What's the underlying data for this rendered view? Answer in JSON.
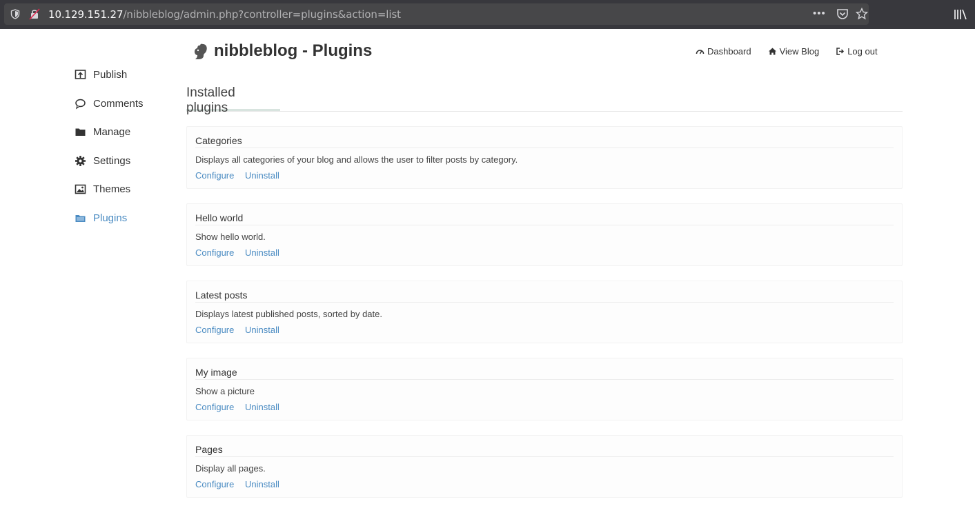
{
  "browser": {
    "url_host": "10.129.151.27",
    "url_path": "/nibbleblog/admin.php?controller=plugins&action=list",
    "more_label": "•••"
  },
  "sidebar": {
    "items": [
      {
        "label": "Publish",
        "icon": "publish-icon"
      },
      {
        "label": "Comments",
        "icon": "comment-icon"
      },
      {
        "label": "Manage",
        "icon": "folder-icon"
      },
      {
        "label": "Settings",
        "icon": "gear-icon"
      },
      {
        "label": "Themes",
        "icon": "image-icon"
      },
      {
        "label": "Plugins",
        "icon": "plugins-icon",
        "active": true
      }
    ]
  },
  "header": {
    "title": "nibbleblog - Plugins",
    "nav": [
      {
        "label": "Dashboard",
        "icon": "dashboard-icon"
      },
      {
        "label": "View Blog",
        "icon": "home-icon"
      },
      {
        "label": "Log out",
        "icon": "logout-icon"
      }
    ]
  },
  "tabs": {
    "active": "Installed plugins"
  },
  "plugins": [
    {
      "name": "Categories",
      "description": "Displays all categories of your blog and allows the user to filter posts by category.",
      "configure": "Configure",
      "uninstall": "Uninstall"
    },
    {
      "name": "Hello world",
      "description": "Show hello world.",
      "configure": "Configure",
      "uninstall": "Uninstall"
    },
    {
      "name": "Latest posts",
      "description": "Displays latest published posts, sorted by date.",
      "configure": "Configure",
      "uninstall": "Uninstall"
    },
    {
      "name": "My image",
      "description": "Show a picture",
      "configure": "Configure",
      "uninstall": "Uninstall"
    },
    {
      "name": "Pages",
      "description": "Display all pages.",
      "configure": "Configure",
      "uninstall": "Uninstall"
    }
  ],
  "colors": {
    "accent": "#4a8bc2",
    "browser_bar": "#38383d",
    "url_box": "#474749"
  }
}
